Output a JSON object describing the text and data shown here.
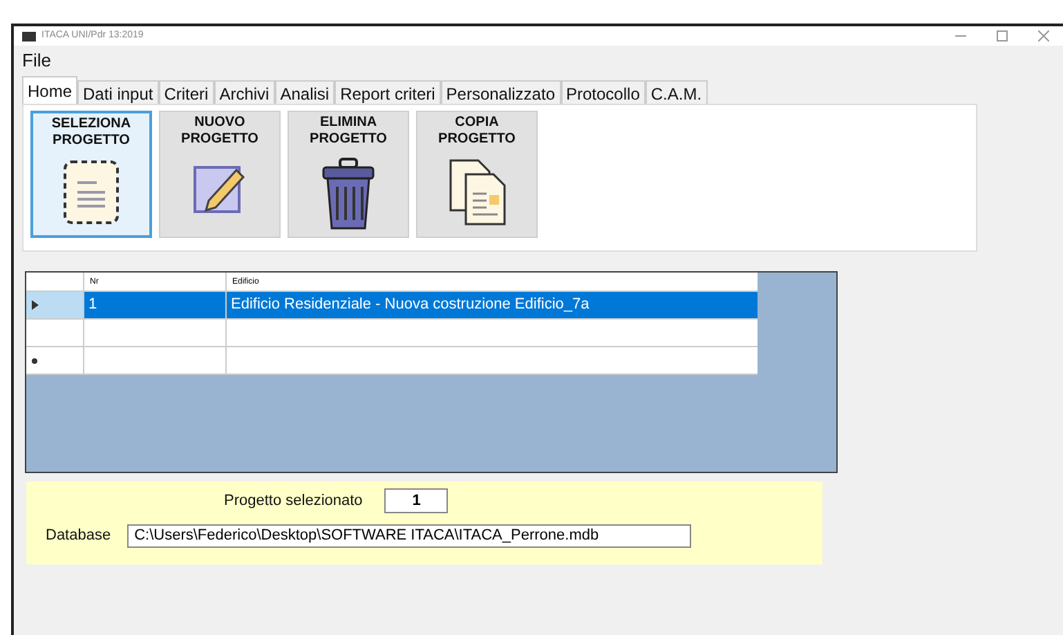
{
  "window": {
    "title": "ITACA UNI/Pdr 13:2019"
  },
  "menu": [
    "File"
  ],
  "tabs": [
    {
      "label": "Home",
      "selected": true
    },
    {
      "label": "Dati input",
      "selected": false
    },
    {
      "label": "Criteri",
      "selected": false
    },
    {
      "label": "Archivi",
      "selected": false
    },
    {
      "label": "Analisi",
      "selected": false
    },
    {
      "label": "Report criteri",
      "selected": false
    },
    {
      "label": "Personalizzato",
      "selected": false
    },
    {
      "label": "Protocollo",
      "selected": false
    },
    {
      "label": "C.A.M.",
      "selected": false
    }
  ],
  "actions": [
    {
      "label": "SELEZIONA PROGETTO",
      "kind": "select",
      "selected": true
    },
    {
      "label": "NUOVO PROGETTO",
      "kind": "new",
      "selected": false
    },
    {
      "label": "ELIMINA PROGETTO",
      "kind": "delete",
      "selected": false
    },
    {
      "label": "COPIA PROGETTO",
      "kind": "copy",
      "selected": false
    }
  ],
  "table": {
    "columns": [
      "Nr",
      "Edificio"
    ],
    "rows": [
      {
        "kind": "current",
        "cells": [
          "1",
          "Edificio Residenziale - Nuova costruzione Edificio_7a"
        ],
        "selected": true
      },
      {
        "kind": "plain",
        "cells": [],
        "selected": false
      },
      {
        "kind": "new",
        "cells": [],
        "selected": false
      }
    ]
  },
  "project": {
    "label": "Progetto selezionato",
    "value": "1"
  },
  "database": {
    "label": "Database",
    "value": "C:\\Users\\Federico\\Desktop\\SOFTWARE ITACA\\ITACA_Perrone.mdb"
  }
}
